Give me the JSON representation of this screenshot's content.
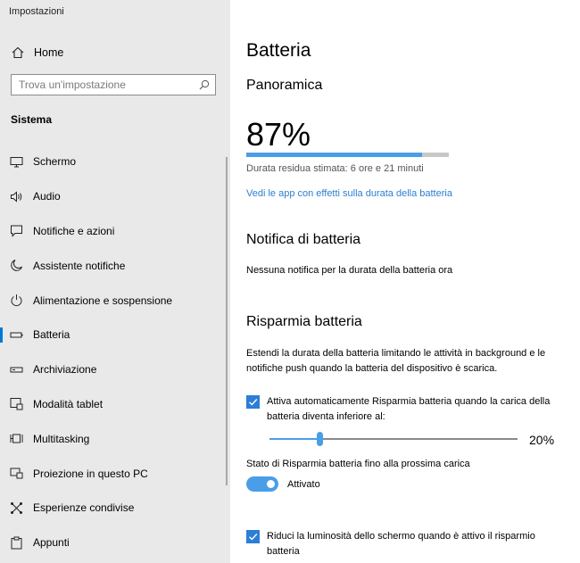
{
  "window": {
    "title": "Impostazioni"
  },
  "sidebar": {
    "home_label": "Home",
    "search_placeholder": "Trova un'impostazione",
    "section_title": "Sistema",
    "items": [
      {
        "label": "Schermo",
        "icon": "monitor-icon"
      },
      {
        "label": "Audio",
        "icon": "speaker-icon"
      },
      {
        "label": "Notifiche e azioni",
        "icon": "notification-icon"
      },
      {
        "label": "Assistente notifiche",
        "icon": "moon-icon"
      },
      {
        "label": "Alimentazione e sospensione",
        "icon": "power-icon"
      },
      {
        "label": "Batteria",
        "icon": "battery-icon",
        "active": true
      },
      {
        "label": "Archiviazione",
        "icon": "storage-icon"
      },
      {
        "label": "Modalità tablet",
        "icon": "tablet-icon"
      },
      {
        "label": "Multitasking",
        "icon": "multitasking-icon"
      },
      {
        "label": "Proiezione in questo PC",
        "icon": "projection-icon"
      },
      {
        "label": "Esperienze condivise",
        "icon": "shared-icon"
      },
      {
        "label": "Appunti",
        "icon": "clipboard-icon"
      }
    ]
  },
  "main": {
    "title": "Batteria",
    "overview": {
      "heading": "Panoramica",
      "percent_text": "87%",
      "level": 0.87,
      "remaining": "Durata residua stimata: 6 ore e 21 minuti",
      "apps_link": "Vedi le app con effetti sulla durata della batteria"
    },
    "notification": {
      "heading": "Notifica di batteria",
      "text": "Nessuna notifica per la durata della batteria ora"
    },
    "saver": {
      "heading": "Risparmia batteria",
      "description_line1": "Estendi la durata della batteria limitando le attività in background e le",
      "description_line2": "notifiche push quando la batteria del dispositivo è scarica.",
      "auto_checkbox_line1": "Attiva automaticamente Risparmia batteria quando la carica della",
      "auto_checkbox_line2": "batteria diventa inferiore al:",
      "auto_checked": true,
      "threshold_percent": 20,
      "threshold_text": "20%",
      "status_label": "Stato di Risparmia batteria fino alla prossima carica",
      "toggle_on": true,
      "toggle_text": "Attivato",
      "brightness_line1": "Riduci la luminosità dello schermo quando è attivo il risparmio",
      "brightness_line2": "batteria",
      "brightness_checked": true
    }
  },
  "colors": {
    "accent": "#0078d7",
    "link": "#2c7fd0",
    "sidebar_bg": "#e9e9e9",
    "progress": "#4a9ee8"
  }
}
